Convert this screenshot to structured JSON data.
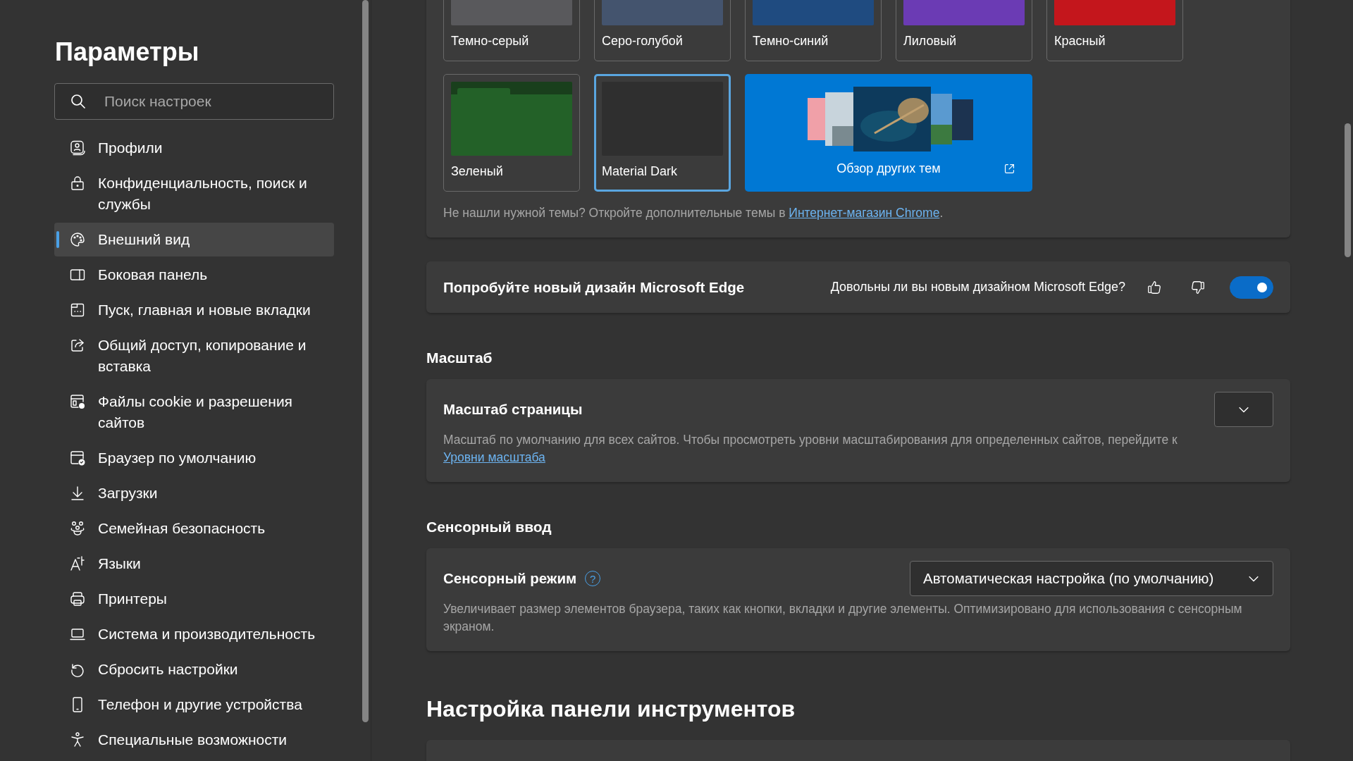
{
  "sidebar": {
    "title": "Параметры",
    "search": {
      "placeholder": "Поиск настроек"
    },
    "items": [
      {
        "label": "Профили",
        "kind": "profile",
        "selected": false
      },
      {
        "label": "Конфиденциальность, поиск и службы",
        "kind": "lock",
        "selected": false
      },
      {
        "label": "Внешний вид",
        "kind": "palette",
        "selected": true
      },
      {
        "label": "Боковая панель",
        "kind": "sidebar",
        "selected": false
      },
      {
        "label": "Пуск, главная и новые вкладки",
        "kind": "newtab",
        "selected": false
      },
      {
        "label": "Общий доступ, копирование и вставка",
        "kind": "share",
        "selected": false
      },
      {
        "label": "Файлы cookie и разрешения сайтов",
        "kind": "cookies",
        "selected": false
      },
      {
        "label": "Браузер по умолчанию",
        "kind": "browser",
        "selected": false
      },
      {
        "label": "Загрузки",
        "kind": "download",
        "selected": false
      },
      {
        "label": "Семейная безопасность",
        "kind": "family",
        "selected": false
      },
      {
        "label": "Языки",
        "kind": "language",
        "selected": false
      },
      {
        "label": "Принтеры",
        "kind": "printer",
        "selected": false
      },
      {
        "label": "Система и производительность",
        "kind": "laptop",
        "selected": false
      },
      {
        "label": "Сбросить настройки",
        "kind": "reset",
        "selected": false
      },
      {
        "label": "Телефон и другие устройства",
        "kind": "phone",
        "selected": false
      },
      {
        "label": "Специальные возможности",
        "kind": "accessibility",
        "selected": false
      }
    ]
  },
  "themes": [
    {
      "label": "Темно-серый",
      "kind": "solid",
      "color": "#59595c",
      "selected": false
    },
    {
      "label": "Серо-голубой",
      "kind": "solid",
      "color": "#44546e",
      "selected": false
    },
    {
      "label": "Темно-синий",
      "kind": "solid",
      "color": "#1f4b80",
      "selected": false
    },
    {
      "label": "Лиловый",
      "kind": "solid",
      "color": "#6b3bb4",
      "selected": false
    },
    {
      "label": "Красный",
      "kind": "solid",
      "color": "#c4161c",
      "selected": false
    },
    {
      "label": "Зеленый",
      "kind": "folder",
      "color": "#236128",
      "selected": false
    },
    {
      "label": "Material Dark",
      "kind": "solid",
      "color": "#2f2f2f",
      "selected": true
    }
  ],
  "store_tile": {
    "label": "Обзор других тем"
  },
  "themes_note": {
    "text": "Не нашли нужной темы? Откройте дополнительные темы в ",
    "link": "Интернет-магазин Chrome",
    "end": "."
  },
  "feedback": {
    "title": "Попробуйте новый дизайн Microsoft Edge",
    "question": "Довольны ли вы новым дизайном Microsoft Edge?",
    "on": true
  },
  "zoom": {
    "heading": "Масштаб",
    "title": "Масштаб страницы",
    "description": "Масштаб по умолчанию для всех сайтов. Чтобы просмотреть уровни масштабирования для определенных сайтов, перейдите к ",
    "link": "Уровни масштаба"
  },
  "touch": {
    "heading": "Сенсорный ввод",
    "title": "Сенсорный режим",
    "help": "?",
    "dropdown": "Автоматическая настройка (по умолчанию)",
    "description": "Увеличивает размер элементов браузера, таких как кнопки, вкладки и другие элементы. Оптимизировано для использования с сенсорным экраном."
  },
  "toolbar": {
    "heading": "Настройка панели инструментов"
  }
}
